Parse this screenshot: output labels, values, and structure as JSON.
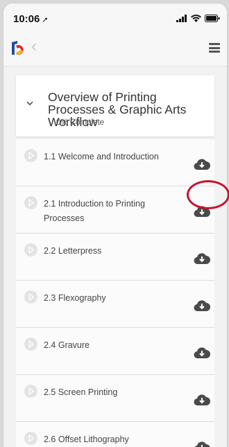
{
  "status_bar": {
    "time": "10:06",
    "location_glyph": "➚"
  },
  "icons": [
    "signal-icon",
    "wifi-icon",
    "battery-icon",
    "app-logo-icon",
    "back-chevron-icon",
    "hamburger-menu-icon",
    "chevron-down-icon",
    "play-icon",
    "cloud-download-icon"
  ],
  "course": {
    "title": "Overview of Printing Processes & Graphic Arts Workflow",
    "progress": "0% Complete"
  },
  "lessons": [
    {
      "label": "1.1 Welcome and Introduction"
    },
    {
      "label": "2.1 Introduction to Printing Processes"
    },
    {
      "label": "2.2 Letterpress"
    },
    {
      "label": "2.3 Flexography"
    },
    {
      "label": "2.4 Gravure"
    },
    {
      "label": "2.5 Screen Printing"
    },
    {
      "label": "2.6 Offset Lithography"
    }
  ],
  "colors": {
    "highlight": "#c8102e",
    "logo_blue": "#1f4ea3",
    "logo_red": "#e0262c",
    "logo_yellow": "#f2b61c"
  }
}
